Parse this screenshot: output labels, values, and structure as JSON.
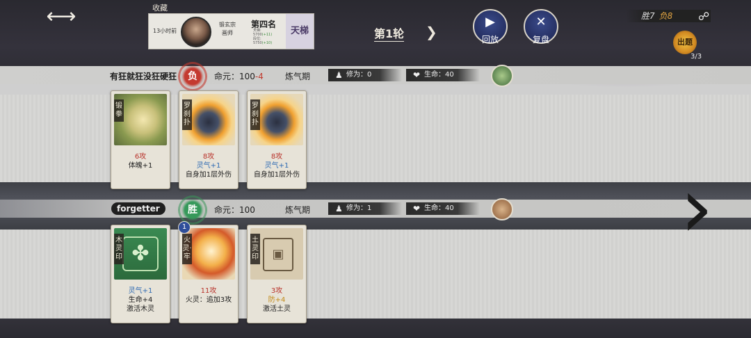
{
  "header": {
    "favorite_label": "收藏",
    "profile": {
      "time_ago": "13小时前",
      "sect": "锻玄宗",
      "role": "画师",
      "rank": "第四名",
      "stats": [
        {
          "label": "天梯:",
          "value": ""
        },
        {
          "label": "5700",
          "delta": "(+11)"
        },
        {
          "label": "段位:",
          "value": ""
        },
        {
          "label": "5750",
          "delta": "(+10)"
        }
      ],
      "ladder_label": "天梯"
    },
    "round_label": "第1轮",
    "replay_label": "回放",
    "review_label": "复盘",
    "wins": "胜7",
    "losses": "负8",
    "emblem_label": "出题",
    "emblem_count": "3/3"
  },
  "players": [
    {
      "name": "有狂就狂没狂硬狂",
      "result": "负",
      "life_label": "命元：100",
      "life_delta": "-4",
      "realm": "炼气期",
      "cultivation": "修为：0",
      "health": "生命：40",
      "cards": [
        {
          "name": "锻拳",
          "atk": "6攻",
          "lines": [
            "体魄+1"
          ]
        },
        {
          "name": "罗刹扑",
          "atk": "8攻",
          "qi": "灵气+1",
          "lines": [
            "自身加1层外伤"
          ]
        },
        {
          "name": "罗刹扑",
          "atk": "8攻",
          "qi": "灵气+1",
          "lines": [
            "自身加1层外伤"
          ]
        }
      ]
    },
    {
      "name": "forgetter",
      "result": "胜",
      "life_label": "命元：100",
      "life_delta": "",
      "realm": "炼气期",
      "cultivation": "修为：1",
      "health": "生命：40",
      "cards": [
        {
          "name": "木灵印",
          "qi": "灵气+1",
          "lines": [
            "生命+4",
            "激活木灵"
          ]
        },
        {
          "name": "火灵·牢",
          "atk": "11攻",
          "level": "1",
          "lines": [
            "火灵：追加3攻"
          ]
        },
        {
          "name": "土灵印",
          "atk": "3攻",
          "def": "防+4",
          "lines": [
            "激活土灵"
          ]
        }
      ]
    }
  ],
  "icons": {
    "back": "back-arrow-icon",
    "play": "play-icon",
    "crossed_swords": "crossed-swords-icon",
    "share": "share-icon",
    "cultivation": "meditation-icon",
    "health": "heart-icon",
    "next": "next-chevron-icon"
  }
}
